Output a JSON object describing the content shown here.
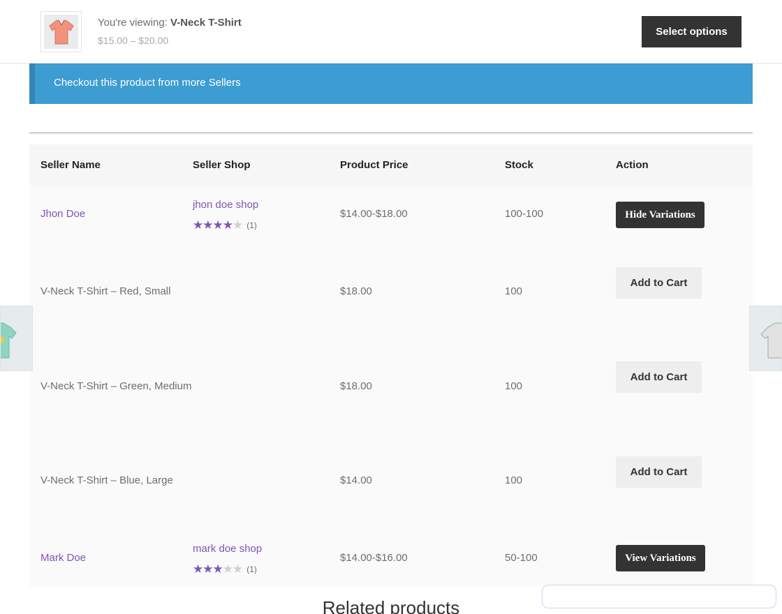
{
  "sticky": {
    "viewing_prefix": "You're viewing: ",
    "product_name": "V-Neck T-Shirt",
    "price_range": "$15.00 – $20.00",
    "select_label": "Select options"
  },
  "notice": {
    "text": "Checkout this product from more Sellers"
  },
  "table": {
    "headers": [
      "Seller Name",
      "Seller Shop",
      "Product Price",
      "Stock",
      "Action"
    ],
    "sellers": [
      {
        "name": "Jhon Doe",
        "shop": "jhon doe shop",
        "rating": 4,
        "rating_count": "(1)",
        "price": "$14.00-$18.00",
        "stock": "100-100",
        "action": "Hide Variations"
      },
      {
        "name": "Mark Doe",
        "shop": "mark doe shop",
        "rating": 3,
        "rating_count": "(1)",
        "price": "$14.00-$16.00",
        "stock": "50-100",
        "action": "View Variations"
      }
    ],
    "variations": [
      {
        "name": "V-Neck T-Shirt – Red, Small",
        "price": "$18.00",
        "stock": "100",
        "action": "Add to Cart"
      },
      {
        "name": "V-Neck T-Shirt – Green, Medium",
        "price": "$18.00",
        "stock": "100",
        "action": "Add to Cart"
      },
      {
        "name": "V-Neck T-Shirt – Blue, Large",
        "price": "$14.00",
        "stock": "100",
        "action": "Add to Cart"
      }
    ]
  },
  "related": {
    "title": "Related products"
  },
  "colors": {
    "accent": "#7f54b3",
    "notice": "#3d9cd2",
    "button_dark": "#333333"
  },
  "icons": {
    "prev_product": "mint-tshirt-thumbnail",
    "next_product": "grey-tshirt-thumbnail",
    "star": "star-icon"
  }
}
